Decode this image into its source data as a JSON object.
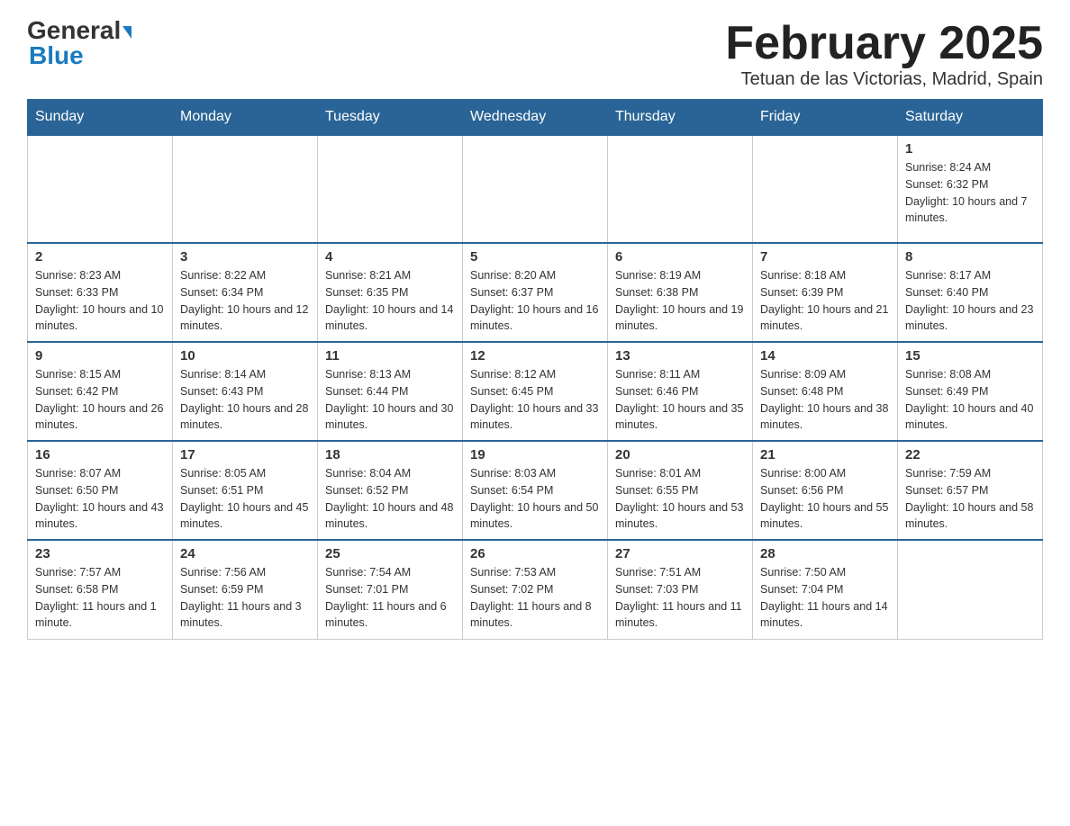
{
  "header": {
    "logo_general": "General",
    "logo_blue": "Blue",
    "title": "February 2025",
    "subtitle": "Tetuan de las Victorias, Madrid, Spain"
  },
  "calendar": {
    "days_of_week": [
      "Sunday",
      "Monday",
      "Tuesday",
      "Wednesday",
      "Thursday",
      "Friday",
      "Saturday"
    ],
    "weeks": [
      [
        {
          "day": "",
          "sunrise": "",
          "sunset": "",
          "daylight": ""
        },
        {
          "day": "",
          "sunrise": "",
          "sunset": "",
          "daylight": ""
        },
        {
          "day": "",
          "sunrise": "",
          "sunset": "",
          "daylight": ""
        },
        {
          "day": "",
          "sunrise": "",
          "sunset": "",
          "daylight": ""
        },
        {
          "day": "",
          "sunrise": "",
          "sunset": "",
          "daylight": ""
        },
        {
          "day": "",
          "sunrise": "",
          "sunset": "",
          "daylight": ""
        },
        {
          "day": "1",
          "sunrise": "Sunrise: 8:24 AM",
          "sunset": "Sunset: 6:32 PM",
          "daylight": "Daylight: 10 hours and 7 minutes."
        }
      ],
      [
        {
          "day": "2",
          "sunrise": "Sunrise: 8:23 AM",
          "sunset": "Sunset: 6:33 PM",
          "daylight": "Daylight: 10 hours and 10 minutes."
        },
        {
          "day": "3",
          "sunrise": "Sunrise: 8:22 AM",
          "sunset": "Sunset: 6:34 PM",
          "daylight": "Daylight: 10 hours and 12 minutes."
        },
        {
          "day": "4",
          "sunrise": "Sunrise: 8:21 AM",
          "sunset": "Sunset: 6:35 PM",
          "daylight": "Daylight: 10 hours and 14 minutes."
        },
        {
          "day": "5",
          "sunrise": "Sunrise: 8:20 AM",
          "sunset": "Sunset: 6:37 PM",
          "daylight": "Daylight: 10 hours and 16 minutes."
        },
        {
          "day": "6",
          "sunrise": "Sunrise: 8:19 AM",
          "sunset": "Sunset: 6:38 PM",
          "daylight": "Daylight: 10 hours and 19 minutes."
        },
        {
          "day": "7",
          "sunrise": "Sunrise: 8:18 AM",
          "sunset": "Sunset: 6:39 PM",
          "daylight": "Daylight: 10 hours and 21 minutes."
        },
        {
          "day": "8",
          "sunrise": "Sunrise: 8:17 AM",
          "sunset": "Sunset: 6:40 PM",
          "daylight": "Daylight: 10 hours and 23 minutes."
        }
      ],
      [
        {
          "day": "9",
          "sunrise": "Sunrise: 8:15 AM",
          "sunset": "Sunset: 6:42 PM",
          "daylight": "Daylight: 10 hours and 26 minutes."
        },
        {
          "day": "10",
          "sunrise": "Sunrise: 8:14 AM",
          "sunset": "Sunset: 6:43 PM",
          "daylight": "Daylight: 10 hours and 28 minutes."
        },
        {
          "day": "11",
          "sunrise": "Sunrise: 8:13 AM",
          "sunset": "Sunset: 6:44 PM",
          "daylight": "Daylight: 10 hours and 30 minutes."
        },
        {
          "day": "12",
          "sunrise": "Sunrise: 8:12 AM",
          "sunset": "Sunset: 6:45 PM",
          "daylight": "Daylight: 10 hours and 33 minutes."
        },
        {
          "day": "13",
          "sunrise": "Sunrise: 8:11 AM",
          "sunset": "Sunset: 6:46 PM",
          "daylight": "Daylight: 10 hours and 35 minutes."
        },
        {
          "day": "14",
          "sunrise": "Sunrise: 8:09 AM",
          "sunset": "Sunset: 6:48 PM",
          "daylight": "Daylight: 10 hours and 38 minutes."
        },
        {
          "day": "15",
          "sunrise": "Sunrise: 8:08 AM",
          "sunset": "Sunset: 6:49 PM",
          "daylight": "Daylight: 10 hours and 40 minutes."
        }
      ],
      [
        {
          "day": "16",
          "sunrise": "Sunrise: 8:07 AM",
          "sunset": "Sunset: 6:50 PM",
          "daylight": "Daylight: 10 hours and 43 minutes."
        },
        {
          "day": "17",
          "sunrise": "Sunrise: 8:05 AM",
          "sunset": "Sunset: 6:51 PM",
          "daylight": "Daylight: 10 hours and 45 minutes."
        },
        {
          "day": "18",
          "sunrise": "Sunrise: 8:04 AM",
          "sunset": "Sunset: 6:52 PM",
          "daylight": "Daylight: 10 hours and 48 minutes."
        },
        {
          "day": "19",
          "sunrise": "Sunrise: 8:03 AM",
          "sunset": "Sunset: 6:54 PM",
          "daylight": "Daylight: 10 hours and 50 minutes."
        },
        {
          "day": "20",
          "sunrise": "Sunrise: 8:01 AM",
          "sunset": "Sunset: 6:55 PM",
          "daylight": "Daylight: 10 hours and 53 minutes."
        },
        {
          "day": "21",
          "sunrise": "Sunrise: 8:00 AM",
          "sunset": "Sunset: 6:56 PM",
          "daylight": "Daylight: 10 hours and 55 minutes."
        },
        {
          "day": "22",
          "sunrise": "Sunrise: 7:59 AM",
          "sunset": "Sunset: 6:57 PM",
          "daylight": "Daylight: 10 hours and 58 minutes."
        }
      ],
      [
        {
          "day": "23",
          "sunrise": "Sunrise: 7:57 AM",
          "sunset": "Sunset: 6:58 PM",
          "daylight": "Daylight: 11 hours and 1 minute."
        },
        {
          "day": "24",
          "sunrise": "Sunrise: 7:56 AM",
          "sunset": "Sunset: 6:59 PM",
          "daylight": "Daylight: 11 hours and 3 minutes."
        },
        {
          "day": "25",
          "sunrise": "Sunrise: 7:54 AM",
          "sunset": "Sunset: 7:01 PM",
          "daylight": "Daylight: 11 hours and 6 minutes."
        },
        {
          "day": "26",
          "sunrise": "Sunrise: 7:53 AM",
          "sunset": "Sunset: 7:02 PM",
          "daylight": "Daylight: 11 hours and 8 minutes."
        },
        {
          "day": "27",
          "sunrise": "Sunrise: 7:51 AM",
          "sunset": "Sunset: 7:03 PM",
          "daylight": "Daylight: 11 hours and 11 minutes."
        },
        {
          "day": "28",
          "sunrise": "Sunrise: 7:50 AM",
          "sunset": "Sunset: 7:04 PM",
          "daylight": "Daylight: 11 hours and 14 minutes."
        },
        {
          "day": "",
          "sunrise": "",
          "sunset": "",
          "daylight": ""
        }
      ]
    ]
  }
}
